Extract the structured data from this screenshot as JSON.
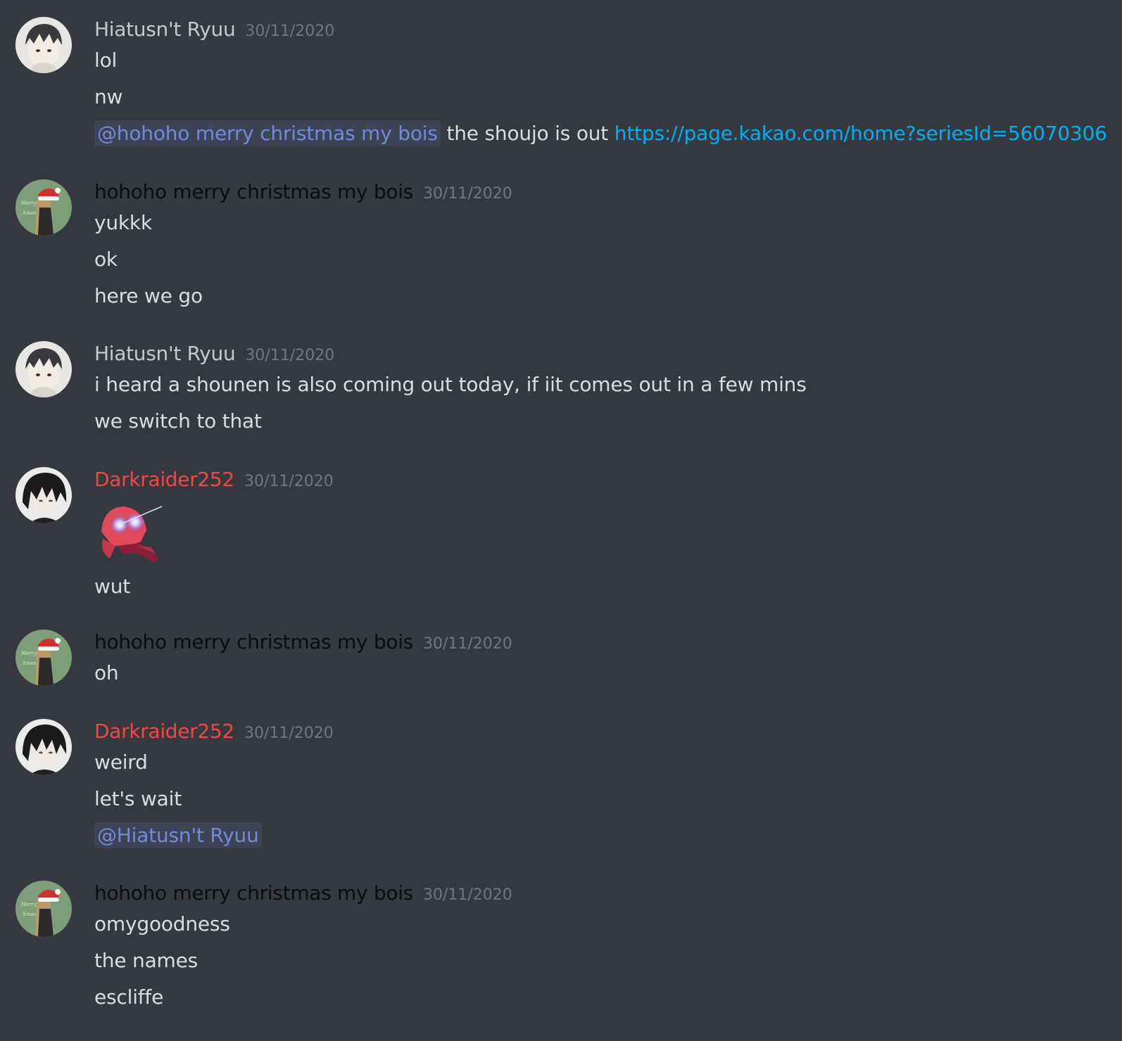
{
  "colors": {
    "background": "#36393f",
    "text": "#dcddde",
    "timestamp": "#72767d",
    "name_default": "#dcddde",
    "name_dark": "#0d0d0d",
    "name_red": "#f04747",
    "mention": "#7289da",
    "link": "#00b0f4"
  },
  "messages": [
    {
      "author": "Hiatusn't Ryuu",
      "avatar_icon": "avatar-ryuu-icon",
      "timestamp": "30/11/2020",
      "lines": [
        "lol",
        "nw",
        {
          "mention": "@hohoho merry christmas my bois",
          "text": " the shoujo is out ",
          "link": "https://page.kakao.com/home?seriesId=56070306"
        }
      ]
    },
    {
      "author": "hohoho merry christmas my bois",
      "avatar_icon": "avatar-santa-hat-icon",
      "timestamp": "30/11/2020",
      "lines": [
        "yukkk",
        "ok",
        "here we go"
      ]
    },
    {
      "author": "Hiatusn't Ryuu",
      "avatar_icon": "avatar-ryuu-icon",
      "timestamp": "30/11/2020",
      "lines": [
        "i heard a shounen is also coming out today, if iit comes out in a few mins",
        "we switch to that"
      ]
    },
    {
      "author": "Darkraider252",
      "avatar_icon": "avatar-dark-hair-icon",
      "timestamp": "30/11/2020",
      "sticker": "glowing-eyes-sticker-icon",
      "lines": [
        "wut"
      ]
    },
    {
      "author": "hohoho merry christmas my bois",
      "avatar_icon": "avatar-santa-hat-icon",
      "timestamp": "30/11/2020",
      "lines": [
        "oh"
      ]
    },
    {
      "author": "Darkraider252",
      "avatar_icon": "avatar-dark-hair-icon",
      "timestamp": "30/11/2020",
      "lines": [
        "weird",
        "let's wait",
        {
          "mention": "@Hiatusn't Ryuu"
        }
      ]
    },
    {
      "author": "hohoho merry christmas my bois",
      "avatar_icon": "avatar-santa-hat-icon",
      "timestamp": "30/11/2020",
      "lines": [
        "omygoodness",
        "the names",
        "escliffe"
      ]
    }
  ]
}
